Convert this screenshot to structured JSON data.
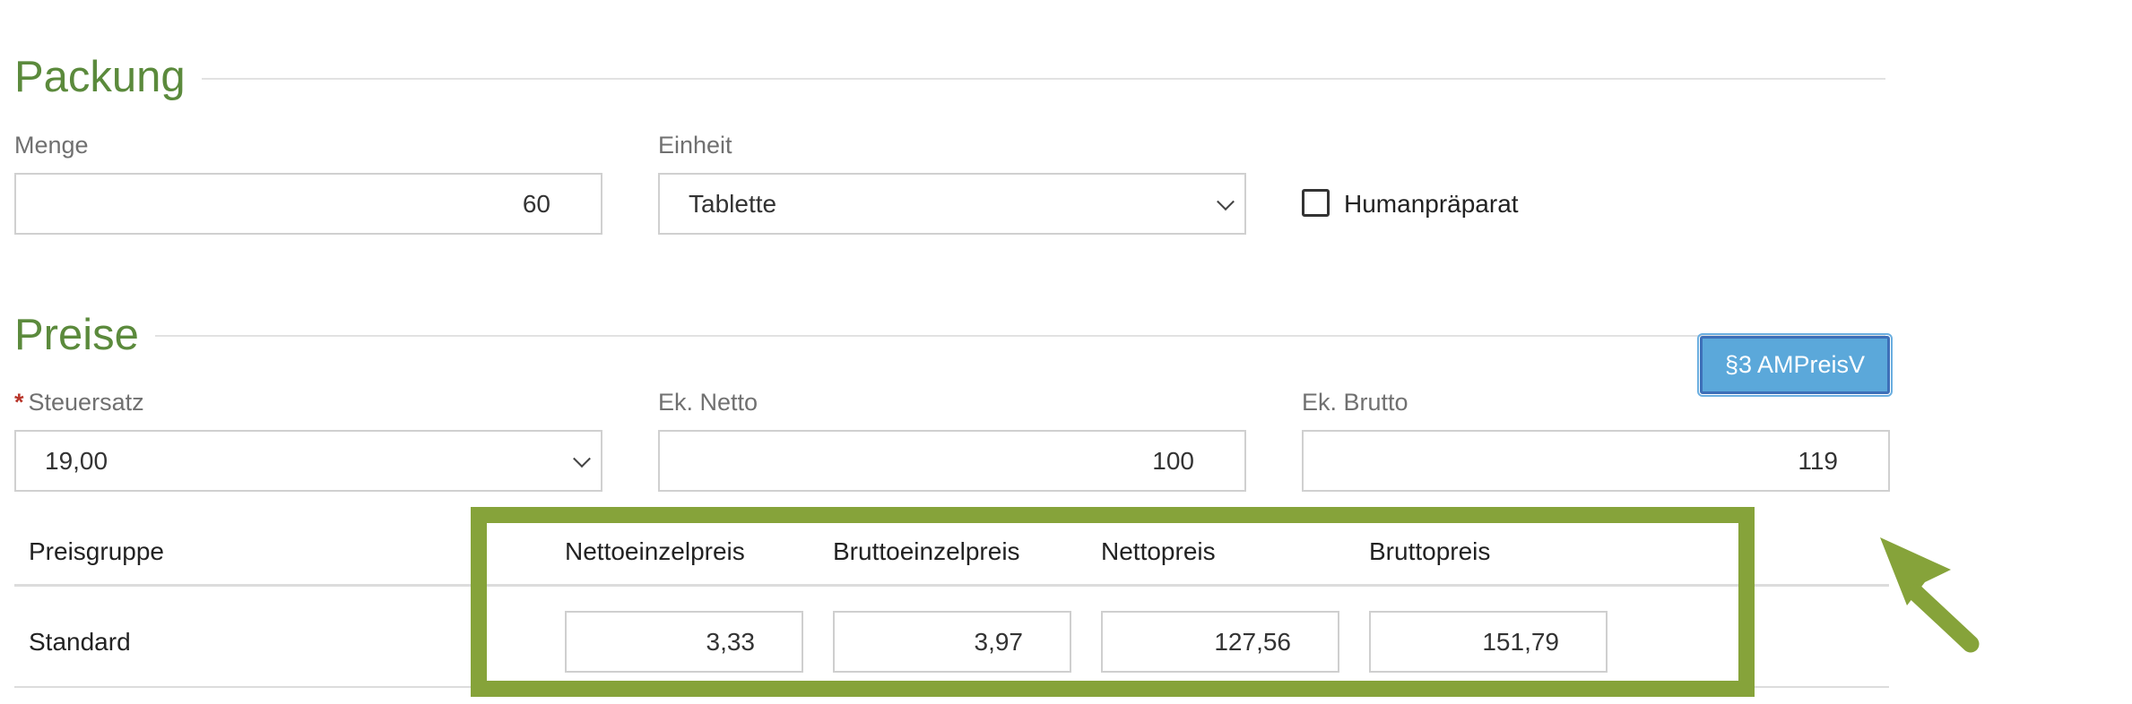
{
  "packung": {
    "title": "Packung",
    "menge_label": "Menge",
    "menge_value": "60",
    "einheit_label": "Einheit",
    "einheit_value": "Tablette",
    "humanpraeparat_label": "Humanpräparat",
    "humanpraeparat_checked": false
  },
  "preise": {
    "title": "Preise",
    "ampreisv_button": "§3 AMPreisV",
    "required_marker": "*",
    "steuersatz_label": "Steuersatz",
    "steuersatz_value": "19,00",
    "ek_netto_label": "Ek. Netto",
    "ek_netto_value": "100",
    "ek_brutto_label": "Ek. Brutto",
    "ek_brutto_value": "119"
  },
  "price_table": {
    "headers": {
      "preisgruppe": "Preisgruppe",
      "nettoeinzelpreis": "Nettoeinzelpreis",
      "bruttoeinzelpreis": "Bruttoeinzelpreis",
      "nettopreis": "Nettopreis",
      "bruttopreis": "Bruttopreis"
    },
    "rows": [
      {
        "preisgruppe": "Standard",
        "nettoeinzelpreis": "3,33",
        "bruttoeinzelpreis": "3,97",
        "nettopreis": "127,56",
        "bruttopreis": "151,79"
      }
    ]
  },
  "annotation": {
    "highlight_color": "#86a33a",
    "arrow_color": "#86a33a"
  }
}
